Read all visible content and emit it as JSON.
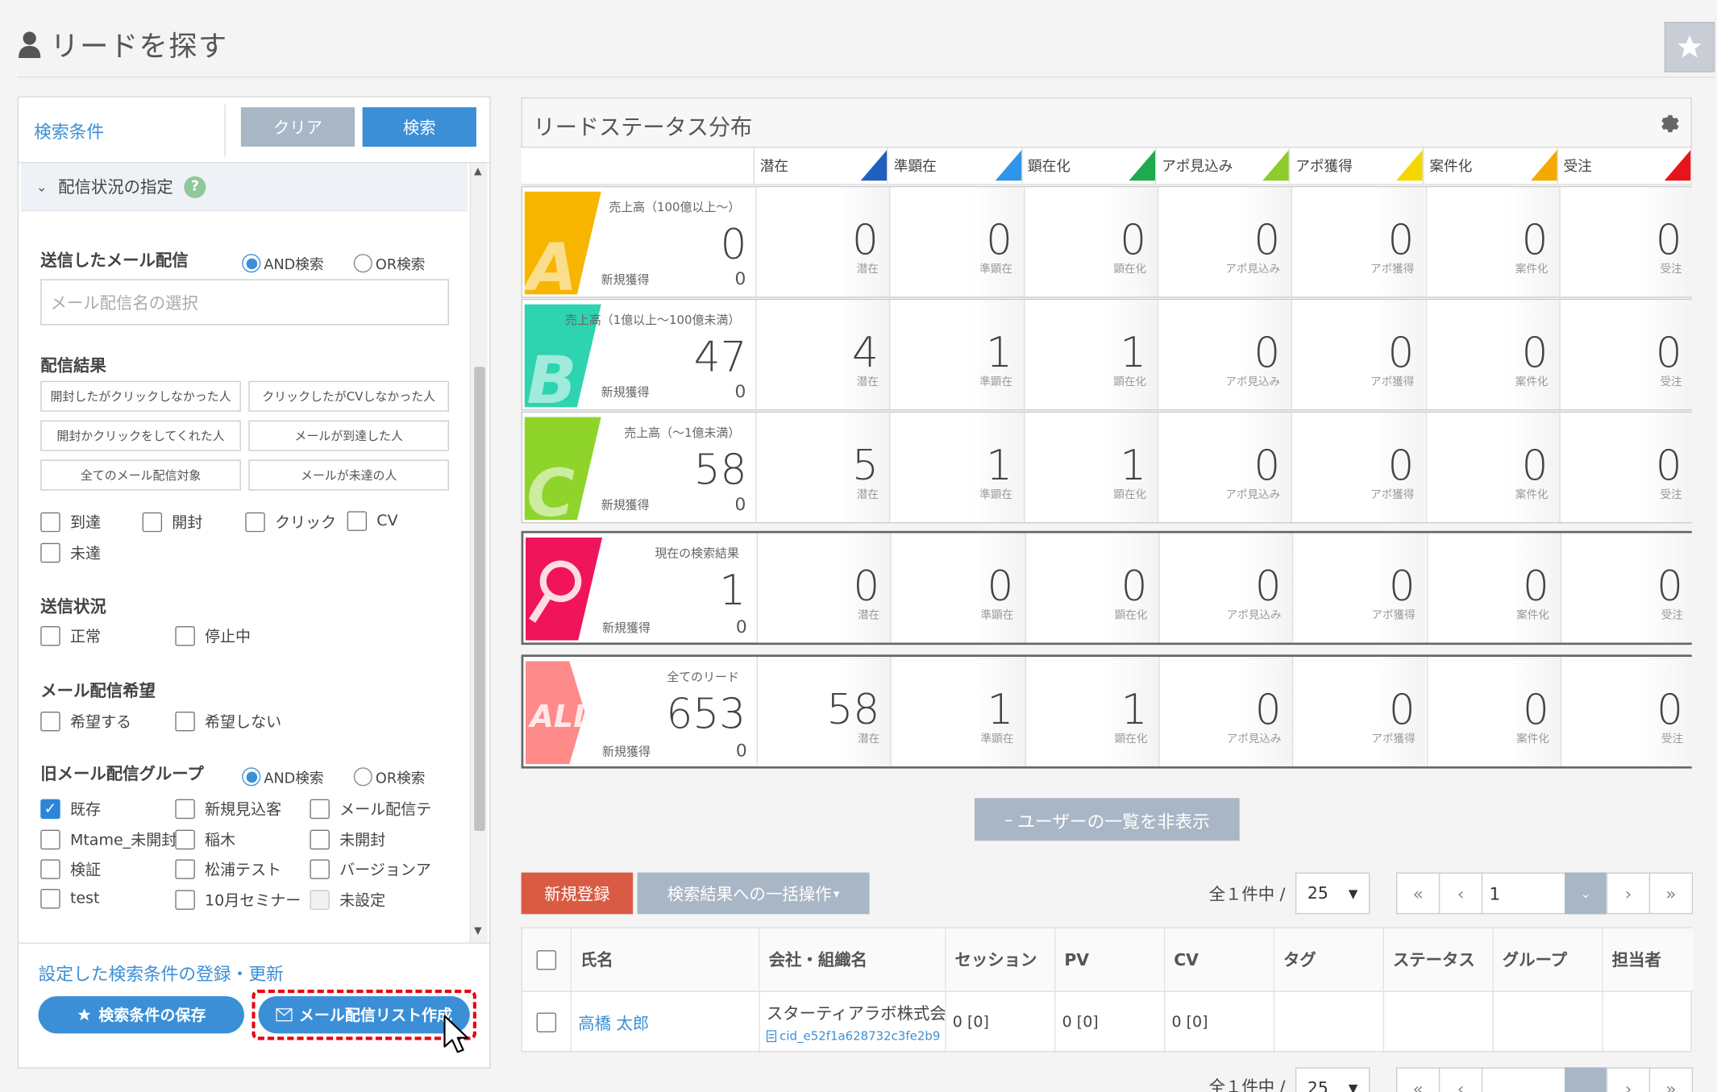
{
  "page": {
    "title": "リードを探す"
  },
  "left_panel": {
    "tab_label": "検索条件",
    "clear_label": "クリア",
    "search_label": "検索",
    "section_title": "配信状況の指定",
    "help": "?",
    "sent_mail": {
      "label": "送信したメール配信",
      "and_label": "AND検索",
      "or_label": "OR検索",
      "placeholder": "メール配信名の選択"
    },
    "result": {
      "label": "配信結果",
      "chips": [
        "開封したがクリックしなかった人",
        "クリックしたがCVしなかった人",
        "開封かクリックをしてくれた人",
        "メールが到達した人",
        "全てのメール配信対象",
        "メールが未達の人"
      ],
      "checks": [
        "到達",
        "開封",
        "クリック",
        "CV",
        "未達"
      ]
    },
    "send_status": {
      "label": "送信状況",
      "checks": [
        "正常",
        "停止中"
      ]
    },
    "preference": {
      "label": "メール配信希望",
      "checks": [
        "希望する",
        "希望しない"
      ]
    },
    "old_group": {
      "label": "旧メール配信グループ",
      "and_label": "AND検索",
      "or_label": "OR検索",
      "checks": [
        "既存",
        "新規見込客",
        "メール配信テ",
        "Mtame_未開封",
        "稲木",
        "未開封",
        "検証",
        "松浦テスト",
        "バージョンア",
        "test",
        "10月セミナー",
        "未設定"
      ]
    },
    "register_link": "設定した検索条件の登録・更新",
    "save_label": "検索条件の保存",
    "list_label": "メール配信リスト作成"
  },
  "status": {
    "title": "リードステータス分布",
    "columns": [
      "潜在",
      "準顕在",
      "顕在化",
      "アポ見込み",
      "アポ獲得",
      "案件化",
      "受注"
    ],
    "column_colors": [
      "#1f5fbf",
      "#2f95e8",
      "#1eaa4f",
      "#8dcc2a",
      "#f5d800",
      "#f5a800",
      "#e8141c"
    ],
    "new_label": "新規獲得",
    "rows": [
      {
        "letter": "A",
        "color": "#f7b500",
        "caption": "売上高（100億以上～）",
        "total": "0",
        "new": "0",
        "values": [
          "0",
          "0",
          "0",
          "0",
          "0",
          "0",
          "0"
        ]
      },
      {
        "letter": "B",
        "color": "#2ed3b0",
        "caption": "売上高（1億以上～100億未満）",
        "total": "47",
        "new": "0",
        "values": [
          "4",
          "1",
          "1",
          "0",
          "0",
          "0",
          "0"
        ]
      },
      {
        "letter": "C",
        "color": "#8fd42a",
        "caption": "売上高（～1億未満）",
        "total": "58",
        "new": "0",
        "values": [
          "5",
          "1",
          "1",
          "0",
          "0",
          "0",
          "0"
        ]
      },
      {
        "letter": "Q",
        "color": "#f0145a",
        "caption": "現在の検索結果",
        "total": "1",
        "new": "0",
        "values": [
          "0",
          "0",
          "0",
          "0",
          "0",
          "0",
          "0"
        ]
      },
      {
        "letter": "ALL",
        "color": "#ff8a8a",
        "caption": "全てのリード",
        "total": "653",
        "new": "0",
        "values": [
          "58",
          "1",
          "1",
          "0",
          "0",
          "0",
          "0"
        ]
      }
    ]
  },
  "list": {
    "hide_label": "ユーザーの一覧を非表示",
    "new_label": "新規登録",
    "bulk_label": "検索結果への一括操作",
    "count": "全１件中 /",
    "per_page": "25",
    "page_input": "1",
    "headers": [
      "氏名",
      "会社・組織名",
      "セッション",
      "PV",
      "CV",
      "タグ",
      "ステータス",
      "グループ",
      "担当者"
    ],
    "row": {
      "name": "高橋 太郎",
      "company": "スターティアラボ株式会",
      "cid": "cid_e52f1a628732c3fe2b9",
      "session": "0 [0]",
      "pv": "0 [0]",
      "cv": "0 [0]"
    }
  }
}
